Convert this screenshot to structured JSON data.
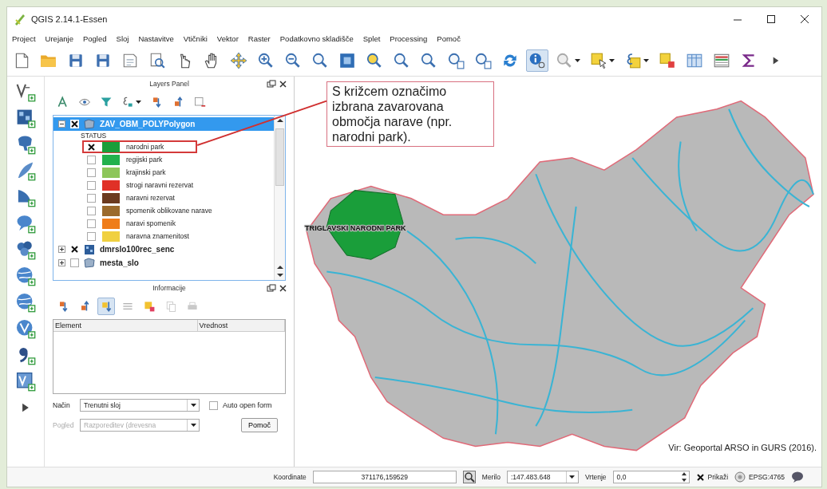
{
  "window": {
    "title": "QGIS 2.14.1-Essen"
  },
  "menu": [
    "Project",
    "Urejanje",
    "Pogled",
    "Sloj",
    "Nastavitve",
    "Vtičniki",
    "Vektor",
    "Raster",
    "Podatkovno skladišče",
    "Splet",
    "Processing",
    "Pomoč"
  ],
  "toolbar": [
    {
      "kind": "page",
      "selected": false
    },
    {
      "kind": "folder",
      "selected": false
    },
    {
      "kind": "disk",
      "selected": false
    },
    {
      "kind": "disk",
      "selected": false
    },
    {
      "kind": "page-lines",
      "selected": false
    },
    {
      "kind": "page-search",
      "selected": false
    },
    {
      "kind": "pointer",
      "selected": false
    },
    {
      "kind": "hand",
      "selected": false
    },
    {
      "kind": "move",
      "selected": false
    },
    {
      "kind": "zoom-in",
      "selected": false
    },
    {
      "kind": "zoom-out",
      "selected": false
    },
    {
      "kind": "zoom",
      "selected": false
    },
    {
      "kind": "zoom-full",
      "selected": false
    },
    {
      "kind": "zoom-yellow",
      "selected": false
    },
    {
      "kind": "zoom",
      "selected": false
    },
    {
      "kind": "zoom",
      "selected": false
    },
    {
      "kind": "zoom-page",
      "selected": false
    },
    {
      "kind": "zoom-page",
      "selected": false
    },
    {
      "kind": "refresh",
      "selected": false
    },
    {
      "kind": "identify",
      "selected": true
    },
    {
      "kind": "zoom-grey",
      "selected": false,
      "dropdown": true
    },
    {
      "kind": "select",
      "selected": false,
      "dropdown": true
    },
    {
      "kind": "expr-select",
      "selected": false,
      "dropdown": true
    },
    {
      "kind": "deselect",
      "selected": false
    },
    {
      "kind": "table",
      "selected": false
    },
    {
      "kind": "table-color",
      "selected": false
    },
    {
      "kind": "sigma",
      "selected": false
    },
    {
      "kind": "more",
      "selected": false
    }
  ],
  "left_toolbar": [
    {
      "kind": "v-layer"
    },
    {
      "kind": "raster"
    },
    {
      "kind": "postgis"
    },
    {
      "kind": "feather"
    },
    {
      "kind": "sail"
    },
    {
      "kind": "bubble"
    },
    {
      "kind": "blob"
    },
    {
      "kind": "globe"
    },
    {
      "kind": "globe"
    },
    {
      "kind": "globe-v"
    },
    {
      "kind": "comma"
    },
    {
      "kind": "virtual"
    },
    {
      "kind": "more"
    }
  ],
  "layers_panel": {
    "title": "Layers Panel",
    "tools": [
      {
        "kind": "paint"
      },
      {
        "kind": "eye"
      },
      {
        "kind": "filter"
      },
      {
        "kind": "expression",
        "dropdown": true
      },
      {
        "kind": "expand"
      },
      {
        "kind": "collapse"
      },
      {
        "kind": "remove"
      }
    ],
    "layers": [
      {
        "name": "ZAV_OBM_POLYPolygon",
        "kind": "vector",
        "checked": true,
        "selected": true,
        "expanded": true,
        "children": [
          {
            "name": "STATUS",
            "children": [
              {
                "name": "narodni park",
                "checked": true,
                "color": "#1a9e3a",
                "highlighted": true
              },
              {
                "name": "regijski park",
                "checked": false,
                "color": "#22b14c",
                "highlighted": false
              },
              {
                "name": "krajinski park",
                "checked": false,
                "color": "#8dc65a",
                "highlighted": false
              },
              {
                "name": "strogi naravni rezervat",
                "checked": false,
                "color": "#e03127",
                "highlighted": false
              },
              {
                "name": "naravni rezervat",
                "checked": false,
                "color": "#6b3a1f",
                "highlighted": false
              },
              {
                "name": "spomenik oblikovane narave",
                "checked": false,
                "color": "#9b6a2c",
                "highlighted": false
              },
              {
                "name": "naravi spomenik",
                "checked": false,
                "color": "#ef7d1a",
                "highlighted": false
              },
              {
                "name": "naravna znamenitost",
                "checked": false,
                "color": "#f0d040",
                "highlighted": false
              }
            ]
          }
        ]
      },
      {
        "name": "dmrslo100rec_senc",
        "kind": "raster",
        "checked": true,
        "selected": false,
        "expanded": false
      },
      {
        "name": "mesta_slo",
        "kind": "vector",
        "checked": false,
        "selected": false,
        "expanded": false
      }
    ]
  },
  "info_panel": {
    "title": "Informacije",
    "tools": [
      {
        "kind": "expand",
        "selected": false,
        "disabled": false
      },
      {
        "kind": "collapse",
        "selected": false,
        "disabled": false
      },
      {
        "kind": "expand-new",
        "selected": true,
        "disabled": false
      },
      {
        "kind": "lines",
        "selected": false,
        "disabled": false
      },
      {
        "kind": "highlight",
        "selected": false,
        "disabled": false
      },
      {
        "kind": "copy",
        "selected": false,
        "disabled": true
      },
      {
        "kind": "print",
        "selected": false,
        "disabled": true
      }
    ],
    "columns": [
      "Element",
      "Vrednost"
    ],
    "mode": {
      "label": "Način",
      "value": "Trenutni sloj"
    },
    "auto_open": {
      "label": "Auto open form",
      "checked": false
    },
    "view": {
      "label": "Pogled",
      "value": "Razporeditev (drevesna",
      "disabled": true
    },
    "help_button": "Pomoč"
  },
  "map": {
    "callout": "S križcem označimo izbrana zavarovana območja narave (npr. narodni park).",
    "park_label": "TRIGLAVSKI NARODNI PARK",
    "credit": "Vir: Geoportal ARSO in GURS (2016)."
  },
  "status_bar": {
    "coordinate_label": "Koordinate",
    "coordinate": "371176,159529",
    "scale_label": "Merilo",
    "scale": ":147.483.648",
    "rotation_label": "Vrtenje",
    "rotation": "0,0",
    "render": {
      "label": "Prikaži",
      "checked": true
    },
    "crs": "EPSG:4765"
  }
}
